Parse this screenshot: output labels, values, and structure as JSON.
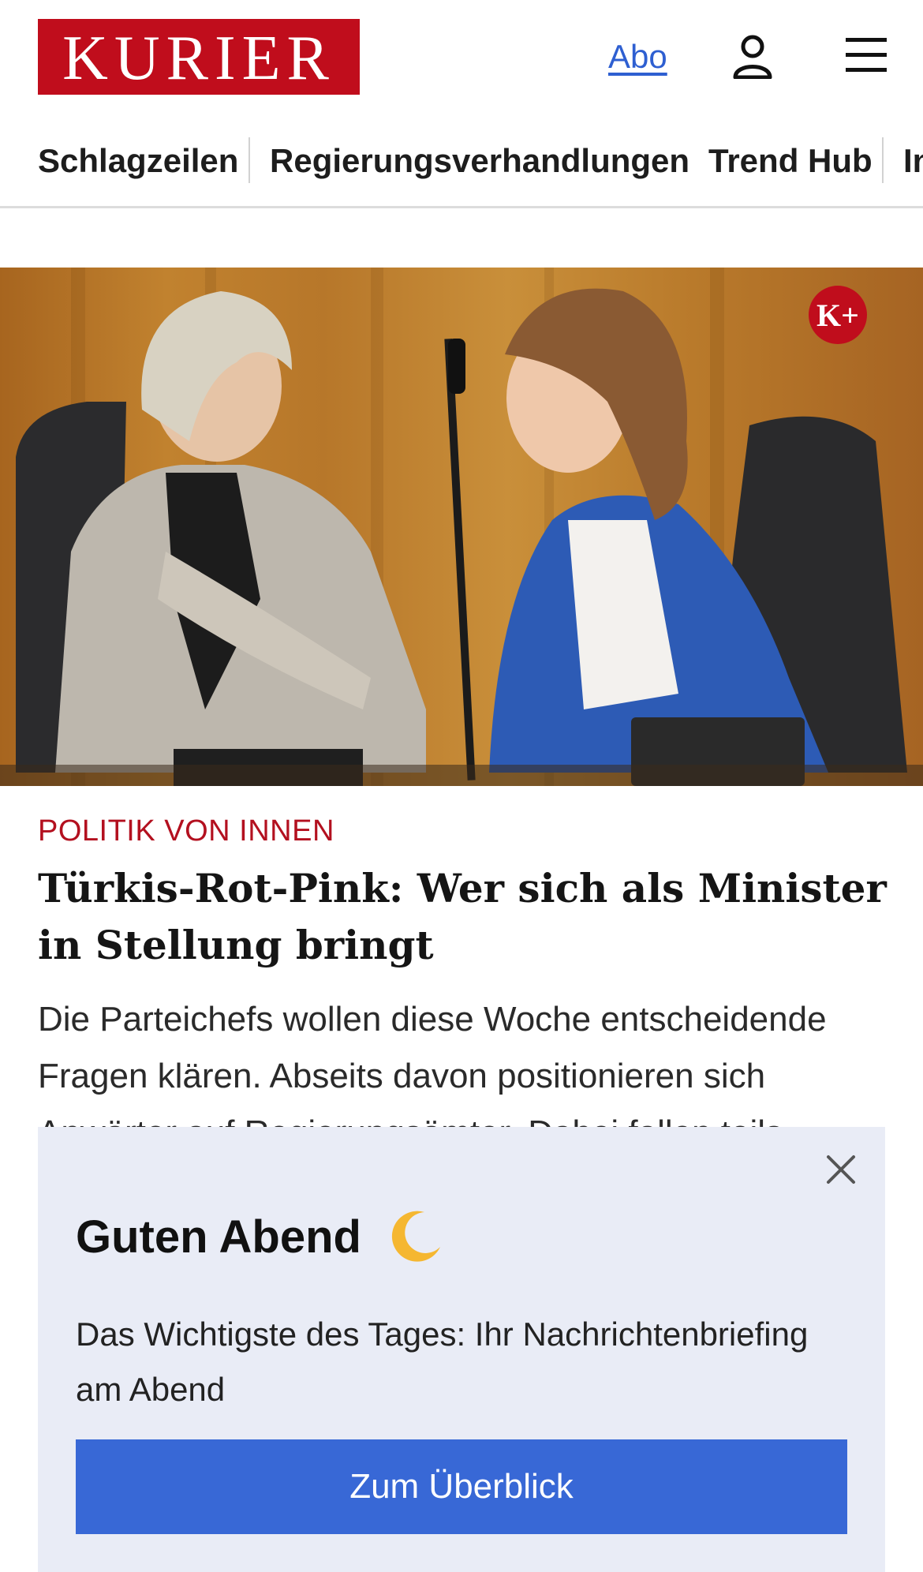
{
  "header": {
    "logo_text": "KURIER",
    "abo_label": "Abo",
    "user_icon": "user-icon",
    "menu_icon": "hamburger-menu-icon",
    "brand_color": "#c00d1c",
    "link_color": "#2e5fd1"
  },
  "nav": {
    "items": [
      "Schlagzeilen",
      "Regierungsverhandlungen",
      "Trend Hub",
      "In"
    ]
  },
  "article": {
    "badge": "K+",
    "kicker": "POLITIK VON INNEN",
    "headline": "Türkis-Rot-Pink: Wer sich als Minister in Stellung bringt",
    "teaser": "Die Parteichefs wollen diese Woche entscheidende Fragen klären. Abseits davon positionieren sich Anwärter auf Regierungsämter. Dabei fallen teils"
  },
  "popup": {
    "greeting": "Guten Abend",
    "greeting_icon": "crescent-moon-icon",
    "text": "Das Wichtigste des Tages: Ihr Nachrichtenbriefing am Abend",
    "cta_label": "Zum Überblick",
    "close_icon": "close-icon",
    "background": "#e9ecf6",
    "cta_color": "#3868d6"
  }
}
